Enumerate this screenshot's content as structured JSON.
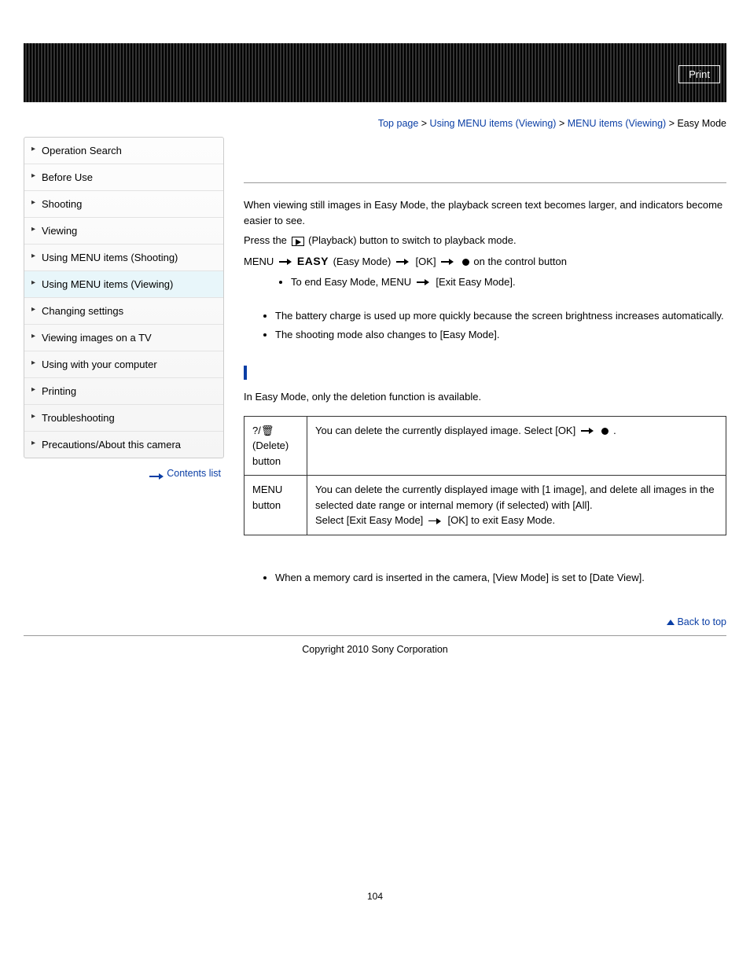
{
  "print_label": "Print",
  "breadcrumb": {
    "top": "Top page",
    "l1": "Using MENU items (Viewing)",
    "l2": "MENU items (Viewing)",
    "current": "Easy Mode",
    "sep": " > "
  },
  "sidebar": {
    "items": [
      "Operation Search",
      "Before Use",
      "Shooting",
      "Viewing",
      "Using MENU items (Shooting)",
      "Using MENU items (Viewing)",
      "Changing settings",
      "Viewing images on a TV",
      "Using with your computer",
      "Printing",
      "Troubleshooting",
      "Precautions/About this camera"
    ],
    "active_index": 5,
    "contents_list": "Contents list"
  },
  "content": {
    "intro": "When viewing still images in Easy Mode, the playback screen text becomes larger, and indicators become easier to see.",
    "step_press_a": "Press the ",
    "step_press_b": " (Playback) button to switch to playback mode.",
    "menu_word": "MENU ",
    "easy_label": "EASY",
    "easy_mode_paren": " (Easy Mode) ",
    "ok_bracket": " [OK] ",
    "on_control": " on the control button",
    "end_easy": "To end Easy Mode, MENU ",
    "exit_easy": " [Exit Easy Mode].",
    "notes": [
      "The battery charge is used up more quickly because the screen brightness increases automatically.",
      "The shooting mode also changes to [Easy Mode]."
    ],
    "funcs_intro": "In Easy Mode, only the deletion function is available.",
    "table": {
      "r1c1a": "(Delete)",
      "r1c1b": "button",
      "r1c2a": "You can delete the currently displayed image. Select [OK] ",
      "r1c2b": " .",
      "r2c1a": "MENU",
      "r2c1b": "button",
      "r2c2a": "You can delete the currently displayed image with [1 image], and delete all images in the selected date range or internal memory (if selected) with [All].",
      "r2c2b": "Select [Exit Easy Mode] ",
      "r2c2c": " [OK] to exit Easy Mode."
    },
    "final_note": "When a memory card is inserted in the camera, [View Mode] is set to [Date View].",
    "back_top": "Back to top",
    "copyright": "Copyright 2010 Sony Corporation",
    "page_number": "104"
  }
}
